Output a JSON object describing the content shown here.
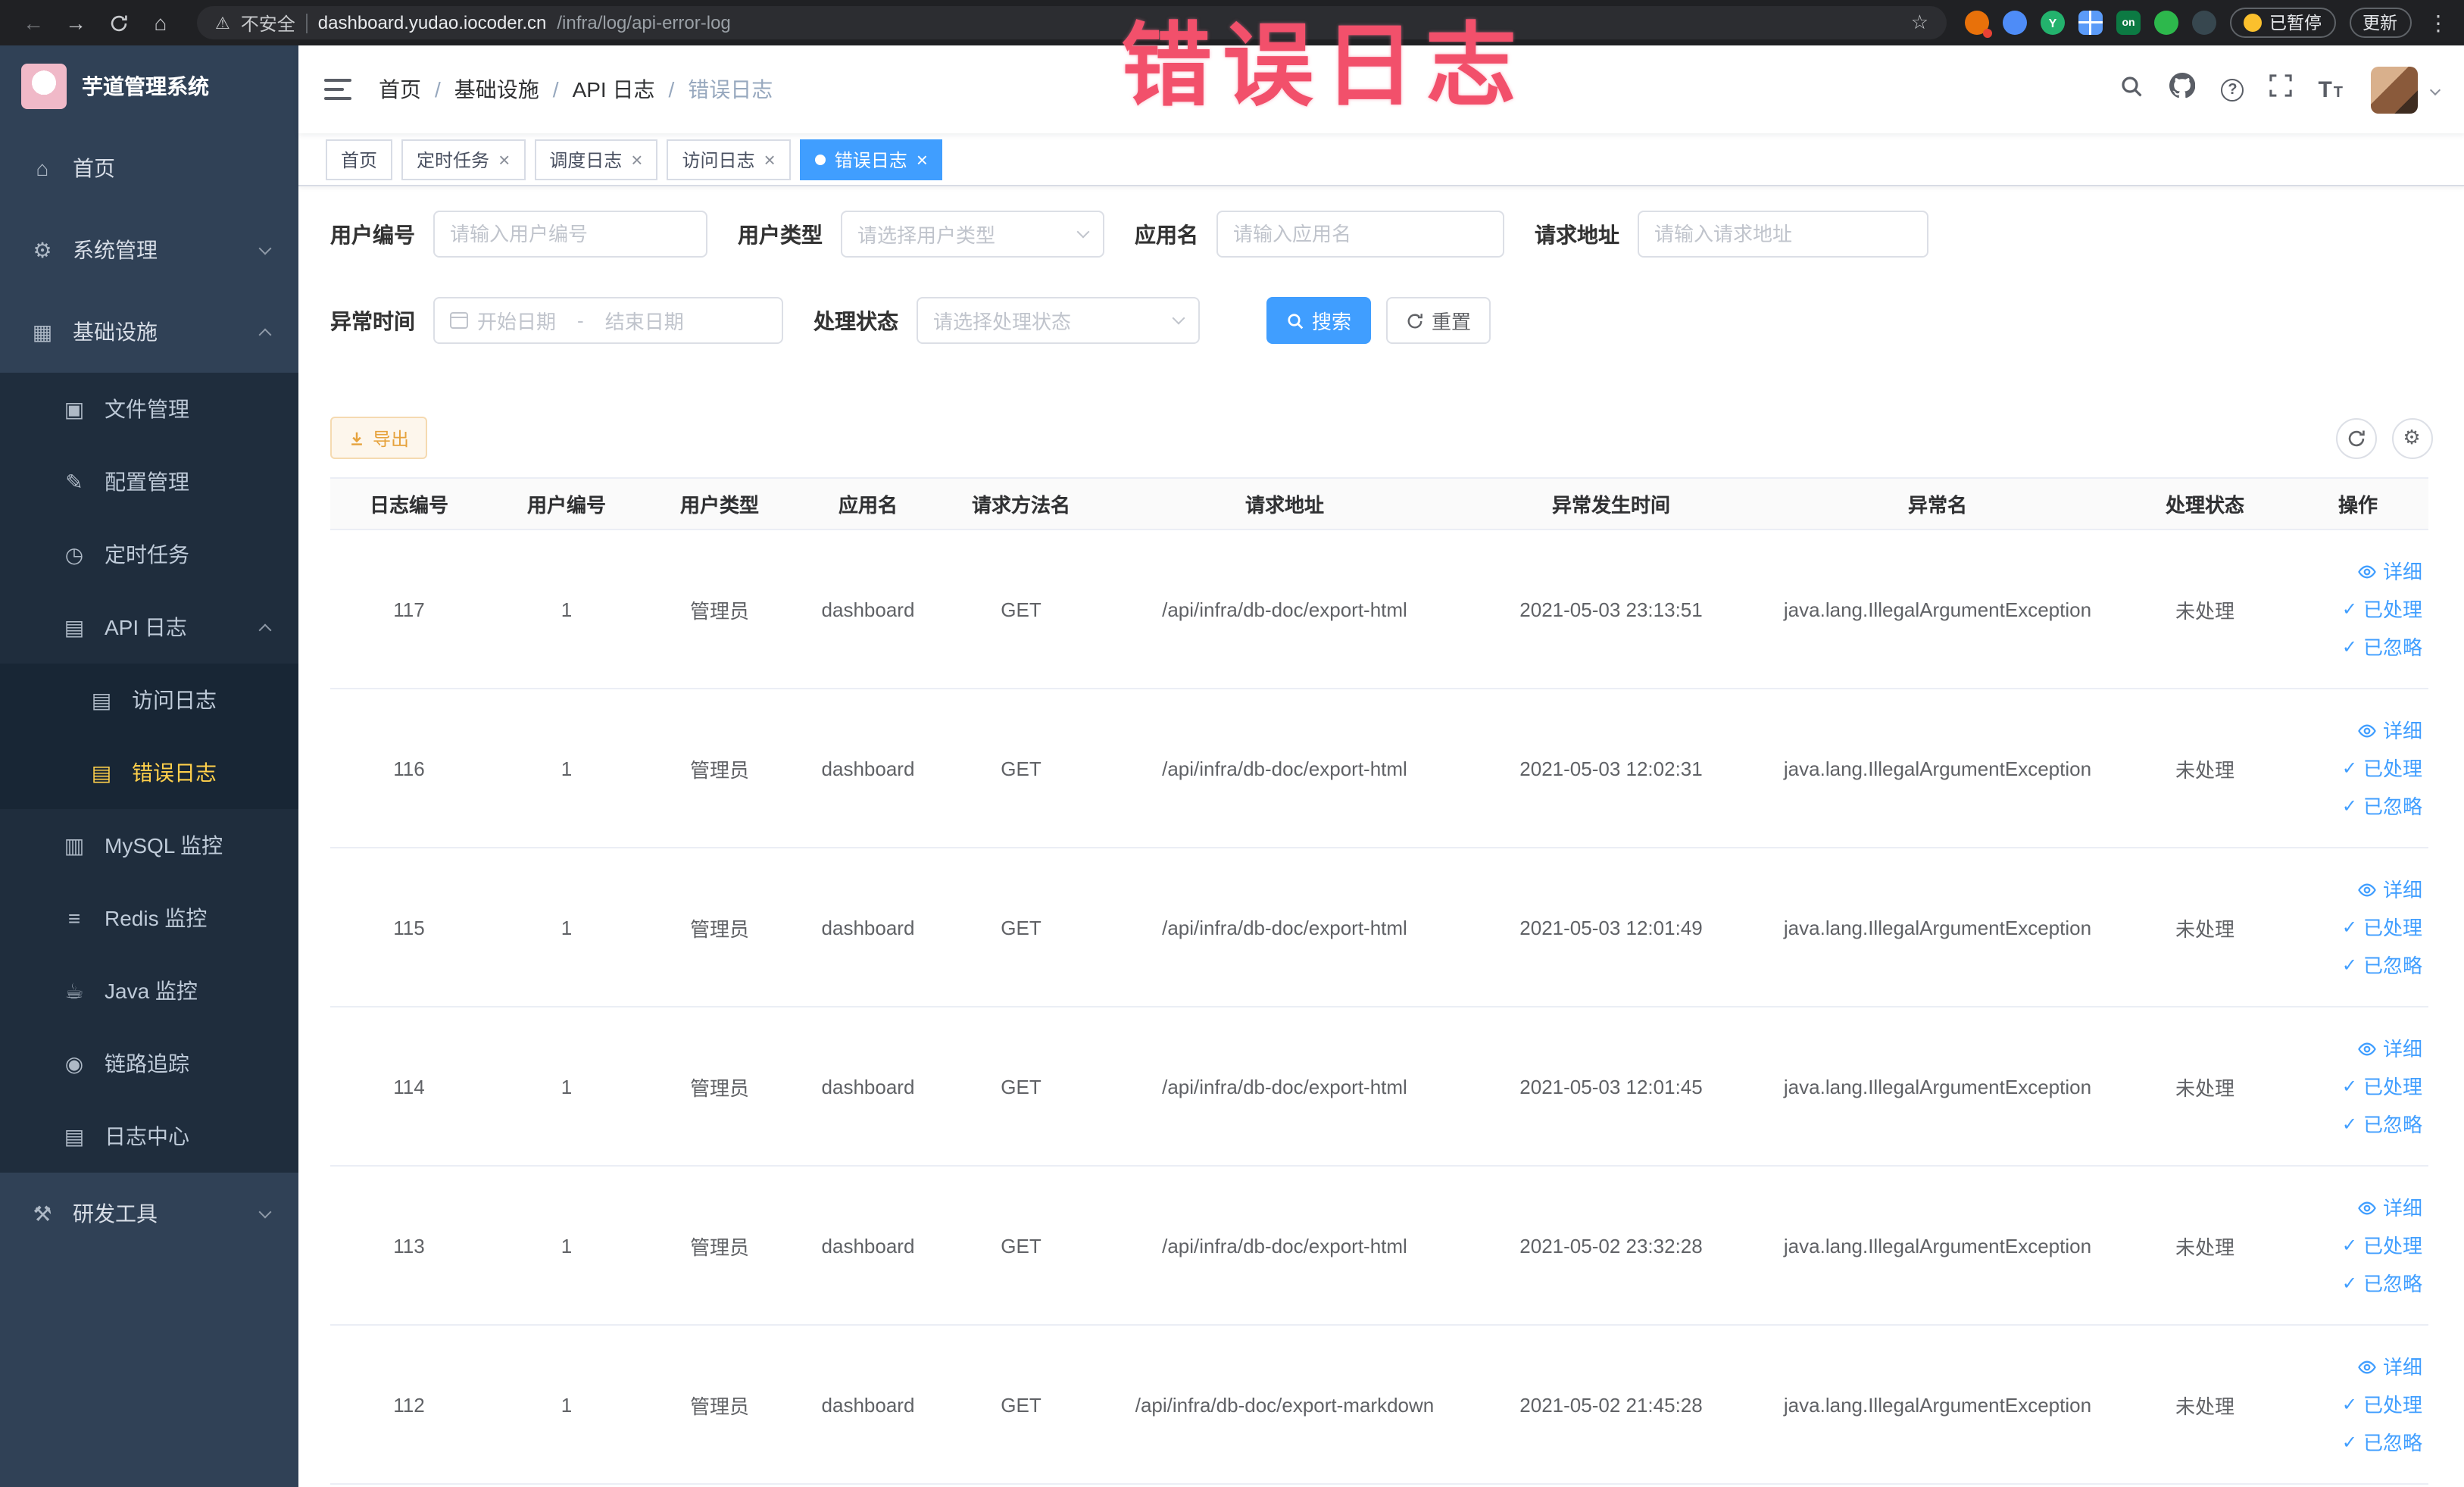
{
  "annotation": {
    "text": "错误日志"
  },
  "icons": {
    "close": "×",
    "check": "✓",
    "gear": "⚙"
  },
  "browser": {
    "back": "←",
    "forward": "→",
    "home": "⌂",
    "warning": "⚠",
    "security_label": "不安全",
    "url_domain": "dashboard.yudao.iocoder.cn",
    "url_path": "/infra/log/api-error-log",
    "star": "☆",
    "ext_y": "Y",
    "ext_on": "on",
    "paused_label": "已暂停",
    "update_label": "更新",
    "kebab": "⋮"
  },
  "sidebar": {
    "app_title": "芋道管理系统",
    "items": {
      "home": {
        "label": "首页",
        "icon": "⌂"
      },
      "system": {
        "label": "系统管理",
        "icon": "⚙"
      },
      "infra": {
        "label": "基础设施",
        "icon": "▦"
      },
      "file": {
        "label": "文件管理",
        "icon": "▣"
      },
      "config": {
        "label": "配置管理",
        "icon": "✎"
      },
      "job": {
        "label": "定时任务",
        "icon": "◷"
      },
      "api_log": {
        "label": "API 日志",
        "icon": "▤"
      },
      "access_log": {
        "label": "访问日志",
        "icon": "▤"
      },
      "error_log": {
        "label": "错误日志",
        "icon": "▤"
      },
      "mysql": {
        "label": "MySQL 监控",
        "icon": "▥"
      },
      "redis": {
        "label": "Redis 监控",
        "icon": "≡"
      },
      "java": {
        "label": "Java 监控",
        "icon": "☕"
      },
      "trace": {
        "label": "链路追踪",
        "icon": "◉"
      },
      "log_center": {
        "label": "日志中心",
        "icon": "▤"
      },
      "dev_tools": {
        "label": "研发工具",
        "icon": "⚒"
      }
    }
  },
  "header": {
    "breadcrumb": [
      "首页",
      "基础设施",
      "API 日志",
      "错误日志"
    ],
    "separator": "/"
  },
  "tabs": [
    {
      "label": "首页"
    },
    {
      "label": "定时任务"
    },
    {
      "label": "调度日志"
    },
    {
      "label": "访问日志"
    },
    {
      "label": "错误日志"
    }
  ],
  "filters": {
    "user_id": {
      "label": "用户编号",
      "placeholder": "请输入用户编号"
    },
    "user_type": {
      "label": "用户类型",
      "placeholder": "请选择用户类型"
    },
    "app_name": {
      "label": "应用名",
      "placeholder": "请输入应用名"
    },
    "request_url": {
      "label": "请求地址",
      "placeholder": "请输入请求地址"
    },
    "exception_time": {
      "label": "异常时间",
      "start_placeholder": "开始日期",
      "separator": "-",
      "end_placeholder": "结束日期"
    },
    "process_status": {
      "label": "处理状态",
      "placeholder": "请选择处理状态"
    },
    "search_label": "搜索",
    "reset_label": "重置"
  },
  "toolbar": {
    "export_label": "导出"
  },
  "table": {
    "columns": [
      "日志编号",
      "用户编号",
      "用户类型",
      "应用名",
      "请求方法名",
      "请求地址",
      "异常发生时间",
      "异常名",
      "处理状态",
      "操作"
    ],
    "actions": [
      "详细",
      "已处理",
      "已忽略"
    ],
    "rows": [
      {
        "id": "117",
        "user_id": "1",
        "user_type": "管理员",
        "app_name": "dashboard",
        "method": "GET",
        "url": "/api/infra/db-doc/export-html",
        "time": "2021-05-03 23:13:51",
        "exception": "java.lang.IllegalArgumentException",
        "status": "未处理"
      },
      {
        "id": "116",
        "user_id": "1",
        "user_type": "管理员",
        "app_name": "dashboard",
        "method": "GET",
        "url": "/api/infra/db-doc/export-html",
        "time": "2021-05-03 12:02:31",
        "exception": "java.lang.IllegalArgumentException",
        "status": "未处理"
      },
      {
        "id": "115",
        "user_id": "1",
        "user_type": "管理员",
        "app_name": "dashboard",
        "method": "GET",
        "url": "/api/infra/db-doc/export-html",
        "time": "2021-05-03 12:01:49",
        "exception": "java.lang.IllegalArgumentException",
        "status": "未处理"
      },
      {
        "id": "114",
        "user_id": "1",
        "user_type": "管理员",
        "app_name": "dashboard",
        "method": "GET",
        "url": "/api/infra/db-doc/export-html",
        "time": "2021-05-03 12:01:45",
        "exception": "java.lang.IllegalArgumentException",
        "status": "未处理"
      },
      {
        "id": "113",
        "user_id": "1",
        "user_type": "管理员",
        "app_name": "dashboard",
        "method": "GET",
        "url": "/api/infra/db-doc/export-html",
        "time": "2021-05-02 23:32:28",
        "exception": "java.lang.IllegalArgumentException",
        "status": "未处理"
      },
      {
        "id": "112",
        "user_id": "1",
        "user_type": "管理员",
        "app_name": "dashboard",
        "method": "GET",
        "url": "/api/infra/db-doc/export-markdown",
        "time": "2021-05-02 21:45:28",
        "exception": "java.lang.IllegalArgumentException",
        "status": "未处理"
      }
    ]
  }
}
